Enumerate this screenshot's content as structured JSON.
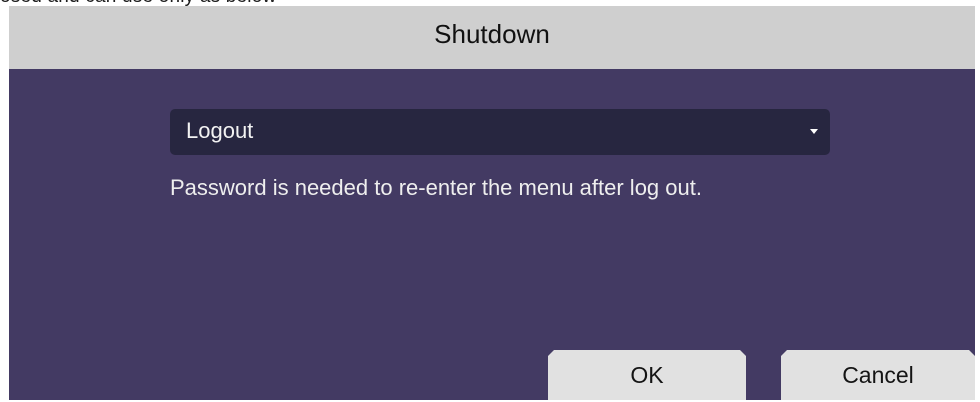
{
  "background_text": "osed and can use only as below",
  "dialog": {
    "title": "Shutdown",
    "dropdown": {
      "selected": "Logout",
      "icon": "caret-down-icon"
    },
    "message": "Password is needed to re-enter the menu after log out.",
    "buttons": {
      "ok_label": "OK",
      "cancel_label": "Cancel"
    }
  },
  "colors": {
    "dialog_bg": "#433a63",
    "titlebar_bg": "#cfcfcf",
    "dropdown_bg": "#272640",
    "button_bg": "#e1e1e1"
  }
}
